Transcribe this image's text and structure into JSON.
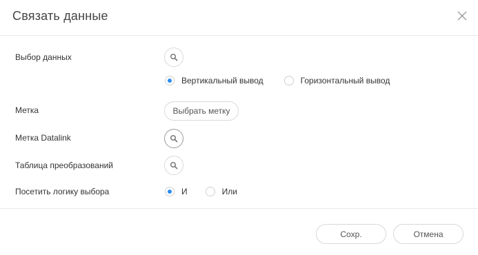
{
  "dialog": {
    "title": "Связать данные"
  },
  "form": {
    "data_select": {
      "label": "Выбор данных",
      "output_options": [
        {
          "label": "Вертикальный вывод",
          "checked": true
        },
        {
          "label": "Горизонтальный вывод",
          "checked": false
        }
      ]
    },
    "tag": {
      "label": "Метка",
      "button_label": "Выбрать метку"
    },
    "datalink_tag": {
      "label": "Метка Datalink"
    },
    "transform_table": {
      "label": "Таблица преобразований"
    },
    "visit_logic": {
      "label": "Посетить логику выбора",
      "options": [
        {
          "label": "И",
          "checked": true
        },
        {
          "label": "Или",
          "checked": false
        }
      ]
    }
  },
  "footer": {
    "save_label": "Сохр.",
    "cancel_label": "Отмена"
  },
  "colors": {
    "accent": "#2d8cf0",
    "border": "#d9d9d9",
    "divider": "#e8e8e8"
  },
  "icons": {
    "close": "close-icon",
    "search": "search-icon"
  }
}
